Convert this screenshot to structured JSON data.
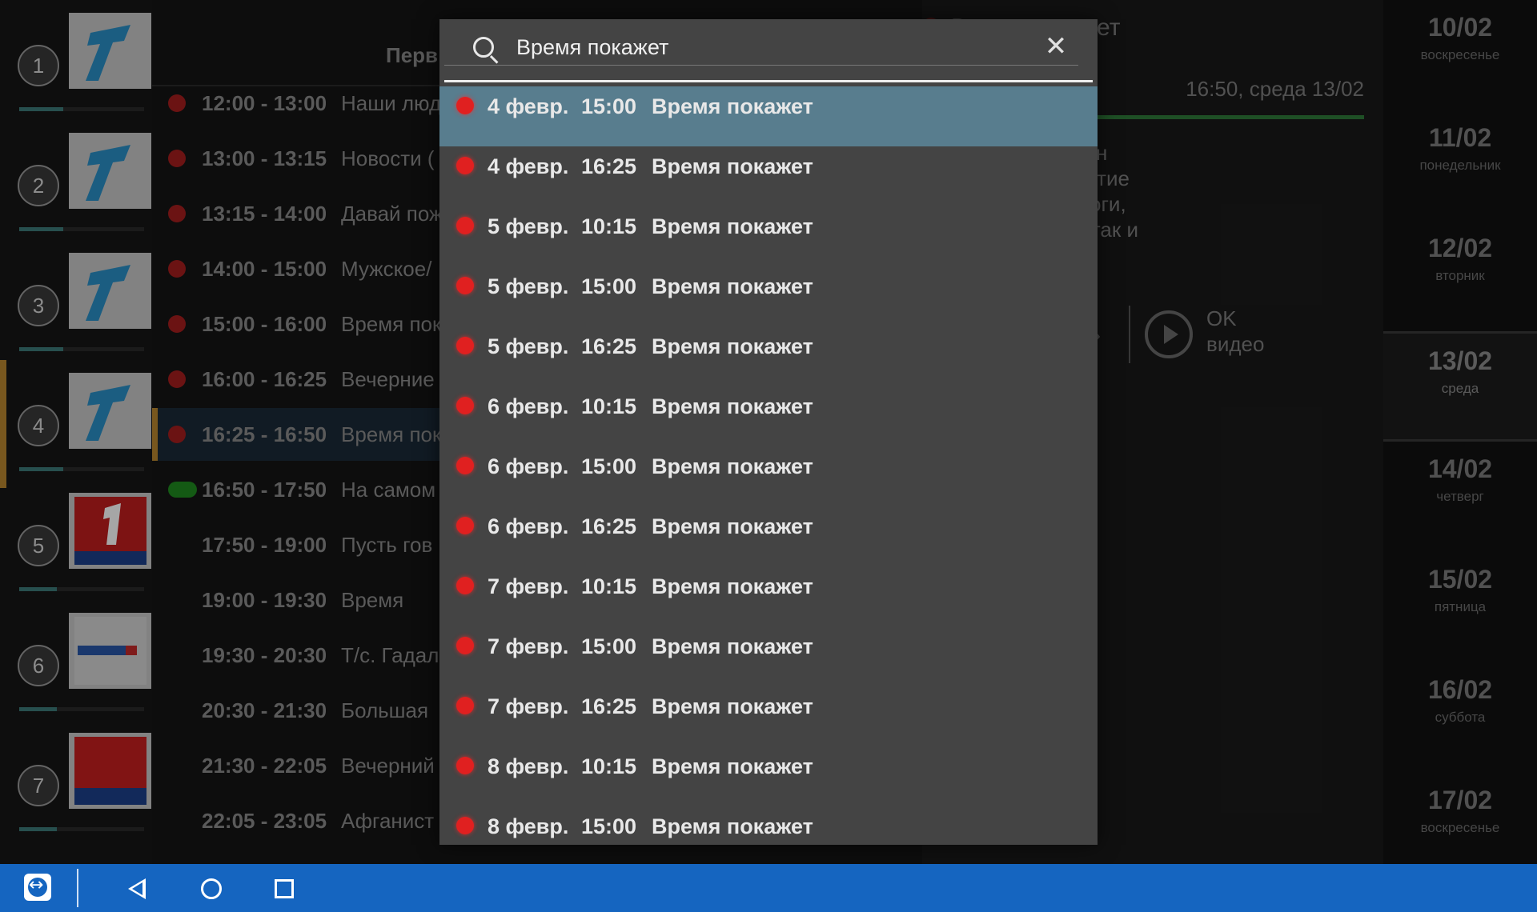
{
  "channels": [
    {
      "num": "1",
      "logo": "first-channel-logo",
      "progress": 0.35
    },
    {
      "num": "2",
      "logo": "first-channel-logo",
      "progress": 0.35
    },
    {
      "num": "3",
      "logo": "first-channel-logo",
      "progress": 0.35
    },
    {
      "num": "4",
      "logo": "first-channel-logo",
      "progress": 0.35,
      "active": true
    },
    {
      "num": "5",
      "logo": "first-channel-russia-logo",
      "progress": 0.3
    },
    {
      "num": "6",
      "logo": "russia-logo",
      "progress": 0.3
    },
    {
      "num": "7",
      "logo": "rtr-planeta-logo",
      "progress": 0.3
    }
  ],
  "programs": {
    "header": "Перв",
    "items": [
      {
        "time": "12:00 - 13:00",
        "title": "Наши люд",
        "rec": true
      },
      {
        "time": "13:00 - 13:15",
        "title": "Новости (",
        "rec": true
      },
      {
        "time": "13:15 - 14:00",
        "title": "Давай пож",
        "rec": true
      },
      {
        "time": "14:00 - 15:00",
        "title": "Мужское/",
        "rec": true
      },
      {
        "time": "15:00 - 16:00",
        "title": "Время пок",
        "rec": true
      },
      {
        "time": "16:00 - 16:25",
        "title": "Вечерние",
        "rec": true
      },
      {
        "time": "16:25 - 16:50",
        "title": "Время пок",
        "rec": true,
        "current": true
      },
      {
        "time": "16:50 - 17:50",
        "title": "На самом",
        "live": true
      },
      {
        "time": "17:50 - 19:00",
        "title": "Пусть гов"
      },
      {
        "time": "19:00 - 19:30",
        "title": "Время"
      },
      {
        "time": "19:30 - 20:30",
        "title": "Т/с. Гадал"
      },
      {
        "time": "20:30 - 21:30",
        "title": "Большая"
      },
      {
        "time": "21:30 - 22:05",
        "title": "Вечерний"
      },
      {
        "time": "22:05 - 23:05",
        "title": "Афганист"
      }
    ]
  },
  "detail": {
    "title": "Время покажет",
    "when": "16:50, среда 13/02",
    "description": "олнующие россиян\nе принимают участие\nолитики, политологи,\nедприниматели - так и\nдушные россияне",
    "ok_line1": "OK",
    "ok_line2": "видео"
  },
  "dates": [
    {
      "date": "10/02",
      "weekday": "воскресенье"
    },
    {
      "date": "11/02",
      "weekday": "понедельник"
    },
    {
      "date": "12/02",
      "weekday": "вторник"
    },
    {
      "date": "13/02",
      "weekday": "среда",
      "selected": true
    },
    {
      "date": "14/02",
      "weekday": "четверг"
    },
    {
      "date": "15/02",
      "weekday": "пятница"
    },
    {
      "date": "16/02",
      "weekday": "суббота"
    },
    {
      "date": "17/02",
      "weekday": "воскресенье"
    }
  ],
  "search": {
    "query": "Время покажет",
    "clear_icon": "close-icon",
    "results": [
      {
        "date": "4 февр.",
        "time": "15:00",
        "title": "Время покажет",
        "selected": true
      },
      {
        "date": "4 февр.",
        "time": "16:25",
        "title": "Время покажет"
      },
      {
        "date": "5 февр.",
        "time": "10:15",
        "title": "Время покажет"
      },
      {
        "date": "5 февр.",
        "time": "15:00",
        "title": "Время покажет"
      },
      {
        "date": "5 февр.",
        "time": "16:25",
        "title": "Время покажет"
      },
      {
        "date": "6 февр.",
        "time": "10:15",
        "title": "Время покажет"
      },
      {
        "date": "6 февр.",
        "time": "15:00",
        "title": "Время покажет"
      },
      {
        "date": "6 февр.",
        "time": "16:25",
        "title": "Время покажет"
      },
      {
        "date": "7 февр.",
        "time": "10:15",
        "title": "Время покажет"
      },
      {
        "date": "7 февр.",
        "time": "15:00",
        "title": "Время покажет"
      },
      {
        "date": "7 февр.",
        "time": "16:25",
        "title": "Время покажет"
      },
      {
        "date": "8 февр.",
        "time": "10:15",
        "title": "Время покажет"
      },
      {
        "date": "8 февр.",
        "time": "15:00",
        "title": "Время покажет"
      }
    ]
  },
  "navbar": {
    "icons": [
      "teamviewer-icon",
      "back-icon",
      "home-icon",
      "recents-icon"
    ]
  },
  "colors": {
    "accent": "#b8862e",
    "record": "#e02020",
    "live": "#1f8a1f",
    "selected_row": "#587d8e",
    "navbar": "#1565c0"
  }
}
